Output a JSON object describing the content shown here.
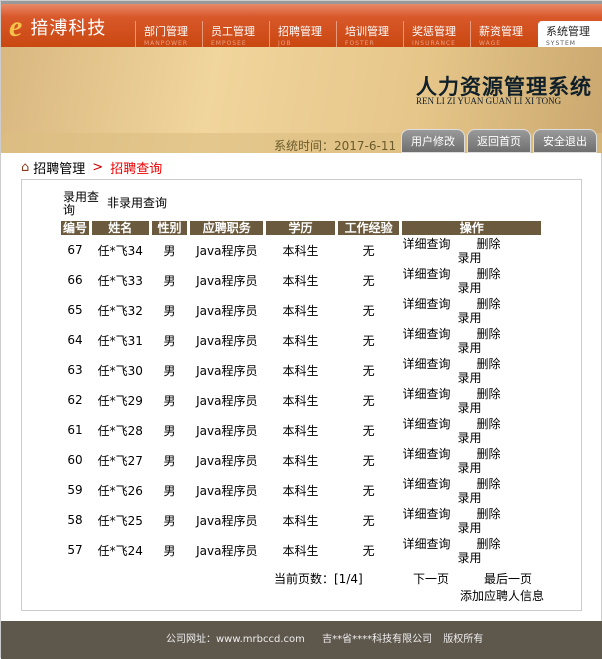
{
  "header": {
    "logo_letter": "e",
    "brand": "揞溥科技",
    "nav": [
      {
        "label": "部门管理",
        "en": "MANPOWER"
      },
      {
        "label": "员工管理",
        "en": "EMPOSEE"
      },
      {
        "label": "招聘管理",
        "en": "JOB"
      },
      {
        "label": "培训管理",
        "en": "FOSTER"
      },
      {
        "label": "奖惩管理",
        "en": "INSURANCE"
      },
      {
        "label": "薪资管理",
        "en": "WAGE"
      },
      {
        "label": "系统管理",
        "en": "SYSTEM"
      }
    ]
  },
  "banner": {
    "title": "人力资源管理系统",
    "pinyin": "REN LI ZI YUAN GUAN LI XI TONG",
    "time": "系统时间：2017-6-11",
    "buttons": [
      "用户修改",
      "返回首页",
      "安全退出"
    ]
  },
  "breadcrumb": {
    "parent": "招聘管理",
    "sep": ">",
    "current": "招聘查询"
  },
  "filters": [
    "录用查询",
    "非录用查询"
  ],
  "table": {
    "headers": [
      "编号",
      "姓名",
      "性别",
      "应聘职务",
      "学历",
      "工作经验",
      "操作"
    ],
    "actions": {
      "detail": "详细查询",
      "delete": "删除",
      "hire": "录用"
    },
    "rows": [
      [
        "67",
        "任*飞34",
        "男",
        "Java程序员",
        "本科生",
        "无"
      ],
      [
        "66",
        "任*飞33",
        "男",
        "Java程序员",
        "本科生",
        "无"
      ],
      [
        "65",
        "任*飞32",
        "男",
        "Java程序员",
        "本科生",
        "无"
      ],
      [
        "64",
        "任*飞31",
        "男",
        "Java程序员",
        "本科生",
        "无"
      ],
      [
        "63",
        "任*飞30",
        "男",
        "Java程序员",
        "本科生",
        "无"
      ],
      [
        "62",
        "任*飞29",
        "男",
        "Java程序员",
        "本科生",
        "无"
      ],
      [
        "61",
        "任*飞28",
        "男",
        "Java程序员",
        "本科生",
        "无"
      ],
      [
        "60",
        "任*飞27",
        "男",
        "Java程序员",
        "本科生",
        "无"
      ],
      [
        "59",
        "任*飞26",
        "男",
        "Java程序员",
        "本科生",
        "无"
      ],
      [
        "58",
        "任*飞25",
        "男",
        "Java程序员",
        "本科生",
        "无"
      ],
      [
        "57",
        "任*飞24",
        "男",
        "Java程序员",
        "本科生",
        "无"
      ]
    ]
  },
  "pager": {
    "current": "当前页数：[1/4]",
    "next": "下一页",
    "last": "最后一页",
    "add": "添加应聘人信息"
  },
  "footer": {
    "site": "公司网址：www.mrbccd.com",
    "company": "吉**省****科技有限公司",
    "rights": "版权所有"
  }
}
